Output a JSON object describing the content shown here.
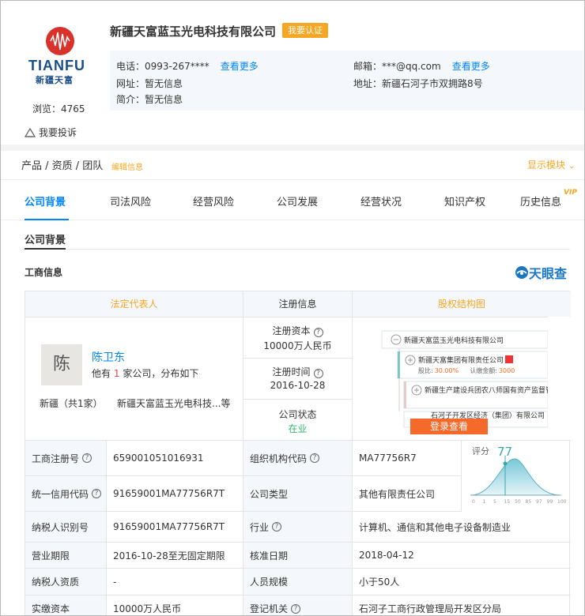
{
  "company": {
    "logo_brand": "TIANFU",
    "logo_cn": "新疆天富",
    "name": "新疆天富蓝玉光电科技有限公司",
    "claim_label": "我要认证",
    "views": "浏览：4765",
    "phone": "电话：0993-267****",
    "email": "邮箱：***@qq.com",
    "more_label": "查看更多",
    "website": "网址：暂无信息",
    "address": "地址：新疆石河子市双拥路8号",
    "intro": "简介：暂无信息",
    "complaint": "我要投诉"
  },
  "section": {
    "title": "产品 / 资质 / 团队",
    "edit": "编辑信息",
    "show_module": "显示模块"
  },
  "tabs": [
    {
      "label": "公司背景"
    },
    {
      "label": "司法风险"
    },
    {
      "label": "经营风险"
    },
    {
      "label": "公司发展"
    },
    {
      "label": "经营状况"
    },
    {
      "label": "知识产权"
    },
    {
      "label": "历史信息"
    }
  ],
  "vip_label": "VIP",
  "sub_title": "公司背景",
  "biz_title": "工商信息",
  "tyc_label": "天眼查",
  "table": {
    "headers": [
      "法定代表人",
      "注册信息",
      "股权结构图"
    ],
    "rep": {
      "avatar": "陈",
      "name": "陈卫东",
      "co_prefix": "他有",
      "co_count": "1",
      "co_suffix": "家公司，分布如下",
      "region": "新疆（共1家）",
      "region_prefix": "新疆（共",
      "region_count": "1",
      "region_suffix": "家）",
      "companies": "新疆天富蓝玉光电科技...等"
    },
    "reg": [
      {
        "label": "注册资本",
        "value": "10000万人民币"
      },
      {
        "label": "注册时间",
        "value": "2016-10-28"
      },
      {
        "label": "公司状态",
        "value": "在业"
      }
    ],
    "equity": {
      "root": "新疆天富蓝玉光电科技有限公司",
      "child1": "新疆天富集团有限责任公司",
      "ratio_label": "股比:",
      "ratio": "30.00%",
      "amount_label": "认缴金额:",
      "amount": "3000",
      "child2": "新疆生产建设兵团农八师国有资产监督管理委",
      "child3": "石河子开发区经济（集团）有限公司",
      "login": "登录查看"
    },
    "rows": [
      {
        "l1": "工商注册号",
        "v1": "659001051016931",
        "l2": "组织机构代码",
        "v2": "MA77756R7"
      },
      {
        "l1": "统一信用代码",
        "v1": "91659001MA77756R7T",
        "l2": "公司类型",
        "v2": "其他有限责任公司"
      },
      {
        "l1": "纳税人识别号",
        "v1": "91659001MA77756R7T",
        "l2": "行业",
        "v2": "计算机、通信和其他电子设备制造业"
      },
      {
        "l1": "营业期限",
        "v1": "2016-10-28至无固定期限",
        "l2": "核准日期",
        "v2": "2018-04-12"
      },
      {
        "l1": "纳税人资质",
        "v1": "-",
        "l2": "人员规模",
        "v2": "小于50人"
      },
      {
        "l1": "实缴资本",
        "v1": "10000万人民币",
        "l2": "登记机关",
        "v2": "石河子工商行政管理局开发区分局"
      }
    ],
    "score": {
      "label": "评分",
      "value": "77",
      "ticks": [
        "0",
        "1",
        "5",
        "15",
        "50",
        "85",
        "97",
        "99",
        "100"
      ]
    }
  }
}
